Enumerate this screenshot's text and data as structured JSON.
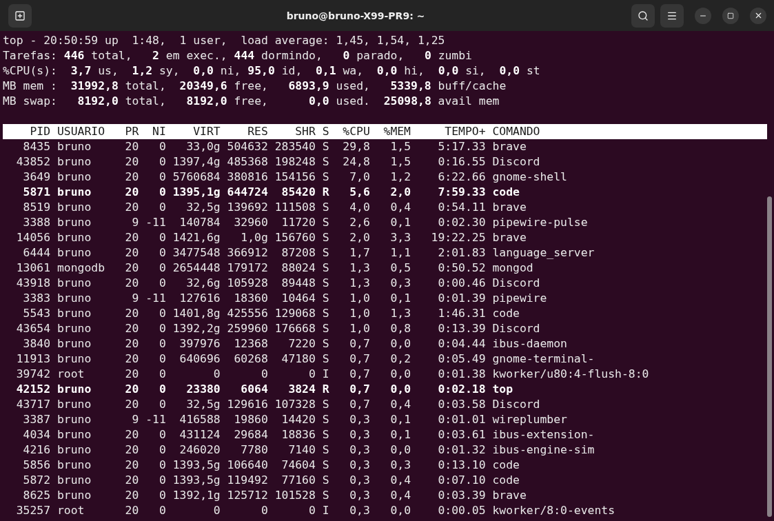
{
  "window": {
    "title": "bruno@bruno-X99-PR9: ~"
  },
  "summary": [
    "top - 20:50:59 up  1:48,  1 user,  load average: 1,45, 1,54, 1,25",
    "Tarefas: **446** total,   **2** em exec., **444** dormindo,   **0** parado,   **0** zumbi",
    "%CPU(s):  **3,7** us,  **1,2** sy,  **0,0** ni, **95,0** id,  **0,1** wa,  **0,0** hi,  **0,0** si,  **0,0** st",
    "MB mem :  **31992,8** total,  **20349,6** free,   **6893,9** used,   **5339,8** buff/cache",
    "MB swap:   **8192,0** total,   **8192,0** free,      **0,0** used.  **25098,8** avail mem"
  ],
  "table": {
    "columns": [
      "PID",
      "USUARIO",
      "PR",
      "NI",
      "VIRT",
      "RES",
      "SHR",
      "S",
      "%CPU",
      "%MEM",
      "TEMPO+",
      "COMANDO"
    ],
    "rows": [
      {
        "highlighted": false,
        "cells": [
          "8435",
          "bruno",
          "20",
          "0",
          "33,0g",
          "504632",
          "283540",
          "S",
          "29,8",
          "1,5",
          "5:17.33",
          "brave"
        ]
      },
      {
        "highlighted": false,
        "cells": [
          "43852",
          "bruno",
          "20",
          "0",
          "1397,4g",
          "485368",
          "198248",
          "S",
          "24,8",
          "1,5",
          "0:16.55",
          "Discord"
        ]
      },
      {
        "highlighted": false,
        "cells": [
          "3649",
          "bruno",
          "20",
          "0",
          "5760684",
          "380816",
          "154156",
          "S",
          "7,0",
          "1,2",
          "6:22.66",
          "gnome-shell"
        ]
      },
      {
        "highlighted": true,
        "cells": [
          "5871",
          "bruno",
          "20",
          "0",
          "1395,1g",
          "644724",
          "85420",
          "R",
          "5,6",
          "2,0",
          "7:59.33",
          "code"
        ]
      },
      {
        "highlighted": false,
        "cells": [
          "8519",
          "bruno",
          "20",
          "0",
          "32,5g",
          "139692",
          "111508",
          "S",
          "4,0",
          "0,4",
          "0:54.11",
          "brave"
        ]
      },
      {
        "highlighted": false,
        "cells": [
          "3388",
          "bruno",
          "9",
          "-11",
          "140784",
          "32960",
          "11720",
          "S",
          "2,6",
          "0,1",
          "0:02.30",
          "pipewire-pulse"
        ]
      },
      {
        "highlighted": false,
        "cells": [
          "14056",
          "bruno",
          "20",
          "0",
          "1421,6g",
          "1,0g",
          "156760",
          "S",
          "2,0",
          "3,3",
          "19:22.25",
          "brave"
        ]
      },
      {
        "highlighted": false,
        "cells": [
          "6444",
          "bruno",
          "20",
          "0",
          "3477548",
          "366912",
          "87208",
          "S",
          "1,7",
          "1,1",
          "2:01.83",
          "language_server"
        ]
      },
      {
        "highlighted": false,
        "cells": [
          "13061",
          "mongodb",
          "20",
          "0",
          "2654448",
          "179172",
          "88024",
          "S",
          "1,3",
          "0,5",
          "0:50.52",
          "mongod"
        ]
      },
      {
        "highlighted": false,
        "cells": [
          "43918",
          "bruno",
          "20",
          "0",
          "32,6g",
          "105928",
          "89448",
          "S",
          "1,3",
          "0,3",
          "0:00.46",
          "Discord"
        ]
      },
      {
        "highlighted": false,
        "cells": [
          "3383",
          "bruno",
          "9",
          "-11",
          "127616",
          "18360",
          "10464",
          "S",
          "1,0",
          "0,1",
          "0:01.39",
          "pipewire"
        ]
      },
      {
        "highlighted": false,
        "cells": [
          "5543",
          "bruno",
          "20",
          "0",
          "1401,8g",
          "425556",
          "129068",
          "S",
          "1,0",
          "1,3",
          "1:46.31",
          "code"
        ]
      },
      {
        "highlighted": false,
        "cells": [
          "43654",
          "bruno",
          "20",
          "0",
          "1392,2g",
          "259960",
          "176668",
          "S",
          "1,0",
          "0,8",
          "0:13.39",
          "Discord"
        ]
      },
      {
        "highlighted": false,
        "cells": [
          "3840",
          "bruno",
          "20",
          "0",
          "397976",
          "12368",
          "7220",
          "S",
          "0,7",
          "0,0",
          "0:04.44",
          "ibus-daemon"
        ]
      },
      {
        "highlighted": false,
        "cells": [
          "11913",
          "bruno",
          "20",
          "0",
          "640696",
          "60268",
          "47180",
          "S",
          "0,7",
          "0,2",
          "0:05.49",
          "gnome-terminal-"
        ]
      },
      {
        "highlighted": false,
        "cells": [
          "39742",
          "root",
          "20",
          "0",
          "0",
          "0",
          "0",
          "I",
          "0,7",
          "0,0",
          "0:01.38",
          "kworker/u80:4-flush-8:0"
        ]
      },
      {
        "highlighted": true,
        "cells": [
          "42152",
          "bruno",
          "20",
          "0",
          "23380",
          "6064",
          "3824",
          "R",
          "0,7",
          "0,0",
          "0:02.18",
          "top"
        ]
      },
      {
        "highlighted": false,
        "cells": [
          "43717",
          "bruno",
          "20",
          "0",
          "32,5g",
          "129616",
          "107328",
          "S",
          "0,7",
          "0,4",
          "0:03.58",
          "Discord"
        ]
      },
      {
        "highlighted": false,
        "cells": [
          "3387",
          "bruno",
          "9",
          "-11",
          "416588",
          "19860",
          "14420",
          "S",
          "0,3",
          "0,1",
          "0:01.01",
          "wireplumber"
        ]
      },
      {
        "highlighted": false,
        "cells": [
          "4034",
          "bruno",
          "20",
          "0",
          "431124",
          "29684",
          "18836",
          "S",
          "0,3",
          "0,1",
          "0:03.61",
          "ibus-extension-"
        ]
      },
      {
        "highlighted": false,
        "cells": [
          "4216",
          "bruno",
          "20",
          "0",
          "246020",
          "7780",
          "7140",
          "S",
          "0,3",
          "0,0",
          "0:01.32",
          "ibus-engine-sim"
        ]
      },
      {
        "highlighted": false,
        "cells": [
          "5856",
          "bruno",
          "20",
          "0",
          "1393,5g",
          "106640",
          "74604",
          "S",
          "0,3",
          "0,3",
          "0:13.10",
          "code"
        ]
      },
      {
        "highlighted": false,
        "cells": [
          "5872",
          "bruno",
          "20",
          "0",
          "1393,5g",
          "119492",
          "77160",
          "S",
          "0,3",
          "0,4",
          "0:07.10",
          "code"
        ]
      },
      {
        "highlighted": false,
        "cells": [
          "8625",
          "bruno",
          "20",
          "0",
          "1392,1g",
          "125712",
          "101528",
          "S",
          "0,3",
          "0,4",
          "0:03.39",
          "brave"
        ]
      },
      {
        "highlighted": false,
        "cells": [
          "35257",
          "root",
          "20",
          "0",
          "0",
          "0",
          "0",
          "I",
          "0,3",
          "0,0",
          "0:00.05",
          "kworker/8:0-events"
        ]
      }
    ]
  }
}
